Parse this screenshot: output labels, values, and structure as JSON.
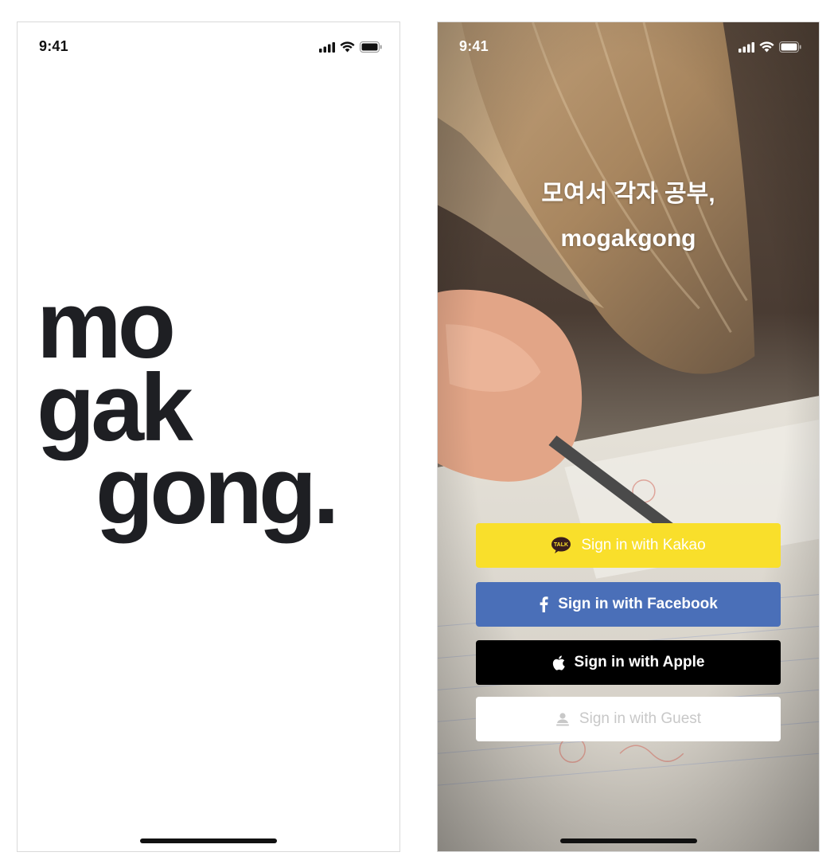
{
  "splash": {
    "status_time": "9:41",
    "wordmark": {
      "line1": "mo",
      "line2": "gak",
      "line3": "gong."
    }
  },
  "login": {
    "status_time": "9:41",
    "tagline": {
      "line1": "모여서 각자 공부,",
      "line2": "mogakgong"
    },
    "buttons": {
      "kakao": "Sign in with Kakao",
      "facebook": "Sign in with Facebook",
      "apple": "Sign in with Apple",
      "guest": "Sign in with Guest"
    },
    "kakao_icon_text": "TALK"
  },
  "colors": {
    "wordmark": "#1e1f23",
    "kakao": "#f9df2b",
    "facebook": "#4a6fb8",
    "apple": "#000000",
    "guest": "#ffffff",
    "guest_text": "#c8c8c8"
  },
  "icons": [
    "cellular-signal-icon",
    "wifi-icon",
    "battery-icon",
    "kakao-talk-icon",
    "facebook-icon",
    "apple-icon",
    "guest-user-icon"
  ]
}
